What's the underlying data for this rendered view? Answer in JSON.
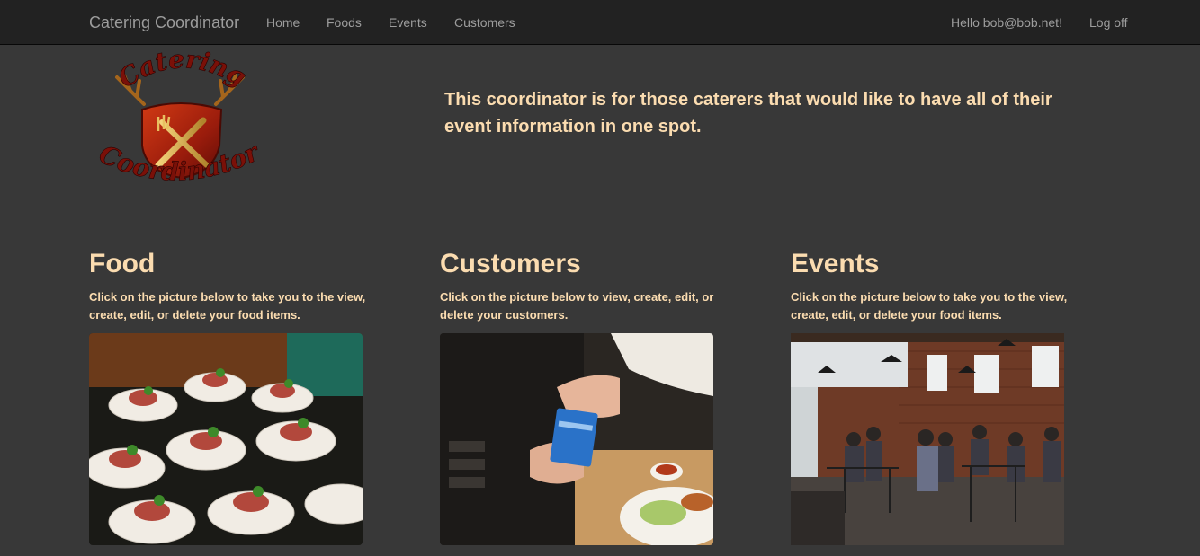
{
  "nav": {
    "brand": "Catering Coordinator",
    "links": [
      "Home",
      "Foods",
      "Events",
      "Customers"
    ],
    "greeting": "Hello bob@bob.net!",
    "logoff": "Log off"
  },
  "logo": {
    "top_word": "Catering",
    "bottom_word": "Coordinator"
  },
  "hero": {
    "tagline": "This coordinator is for those caterers that would like to have all of their event information in one spot."
  },
  "sections": [
    {
      "title": "Food",
      "text": "Click on the picture below to take you to the view, create, edit, or delete your food items."
    },
    {
      "title": "Customers",
      "text": "Click on the picture below to view, create, edit, or delete your customers."
    },
    {
      "title": "Events",
      "text": "Click on the picture below to take you to the view, create, edit, or delete your food items."
    }
  ],
  "colors": {
    "accent": "#fbdcb0",
    "navbar": "#222222",
    "background": "#383838",
    "nav_text": "#9d9d9d"
  }
}
